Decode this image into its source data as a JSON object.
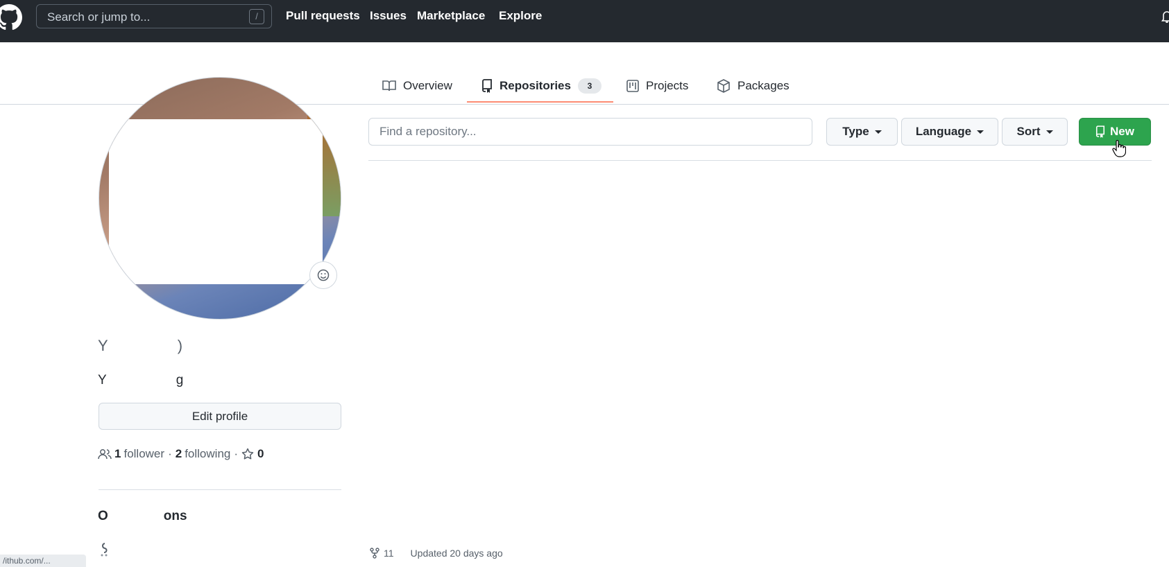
{
  "header": {
    "search_placeholder": "Search or jump to...",
    "search_shortcut": "/",
    "nav": [
      "Pull requests",
      "Issues",
      "Marketplace",
      "Explore"
    ]
  },
  "tabs": [
    {
      "label": "Overview",
      "icon": "book-icon"
    },
    {
      "label": "Repositories",
      "icon": "repo-icon",
      "counter": "3",
      "selected": true
    },
    {
      "label": "Projects",
      "icon": "project-icon"
    },
    {
      "label": "Packages",
      "icon": "package-icon"
    }
  ],
  "profile": {
    "name_partial_start": "Y",
    "name_partial_end": ")",
    "username_partial_start": "Y",
    "username_partial_end": "g",
    "edit_label": "Edit profile",
    "followers_count": "1",
    "followers_label": "follower",
    "following_count": "2",
    "following_label": "following",
    "stars_count": "0",
    "orgs_title_start": "O",
    "orgs_title_end": "ons",
    "status_url": "/ithub.com/..."
  },
  "repos": {
    "search_placeholder": "Find a repository...",
    "filters": [
      "Type",
      "Language",
      "Sort"
    ],
    "new_label": "New",
    "forks": "11",
    "updated": "Updated 20 days ago"
  },
  "colors": {
    "header_bg": "#24292f",
    "accent_underline": "#fd8c73",
    "new_button": "#2da44e"
  }
}
